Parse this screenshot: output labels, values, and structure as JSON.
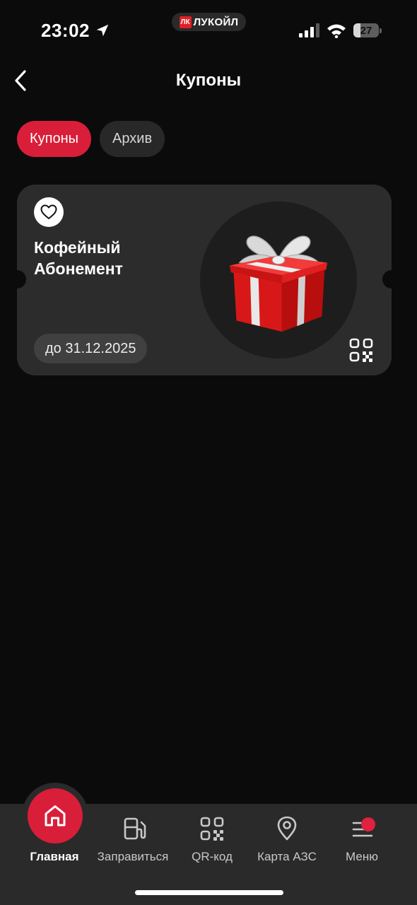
{
  "status_bar": {
    "time": "23:02",
    "brand": "ЛУКОЙЛ",
    "brand_logo_text": "ЛК",
    "battery_percent": "27",
    "battery_level": 0.27
  },
  "header": {
    "title": "Купоны",
    "back_icon": "chevron-left-icon"
  },
  "tabs": [
    {
      "label": "Купоны",
      "active": true
    },
    {
      "label": "Архив",
      "active": false
    }
  ],
  "coupon": {
    "title_line1": "Кофейный",
    "title_line2": "Абонемент",
    "expiry": "до 31.12.2025",
    "favorite_icon": "heart-icon",
    "image_icon": "gift-icon",
    "qr_icon": "qr-code-icon"
  },
  "bottom_nav": {
    "items": [
      {
        "label": "Главная",
        "icon": "home-icon",
        "active": true
      },
      {
        "label": "Заправиться",
        "icon": "fuel-pump-icon",
        "active": false
      },
      {
        "label": "QR-код",
        "icon": "qr-code-icon",
        "active": false
      },
      {
        "label": "Карта АЗС",
        "icon": "map-pin-icon",
        "active": false
      },
      {
        "label": "Меню",
        "icon": "menu-icon",
        "active": false
      }
    ]
  },
  "colors": {
    "accent": "#d91e3a",
    "background": "#0b0b0b",
    "card": "#2c2c2c",
    "nav": "#2a2a2a"
  }
}
